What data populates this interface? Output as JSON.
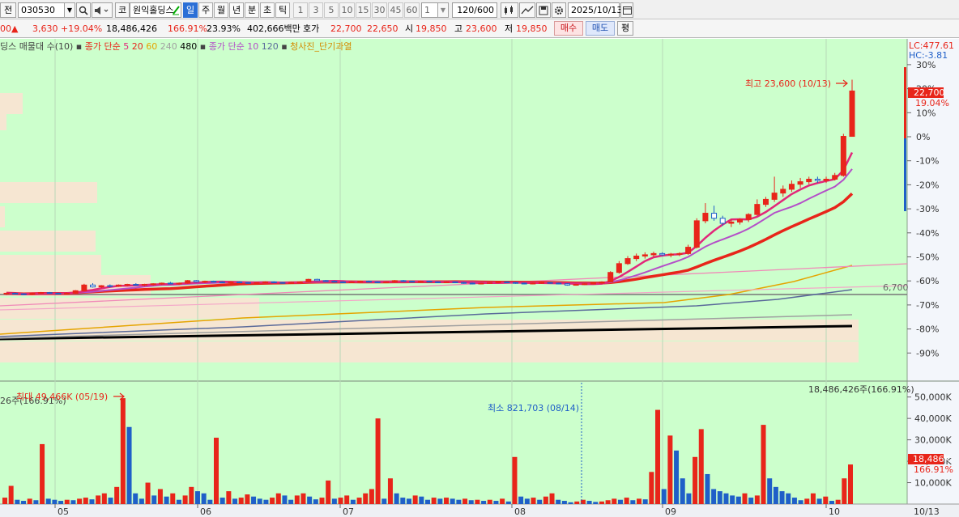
{
  "toolbar": {
    "mode_label": "전",
    "stock_code": "030530",
    "market_label": "코",
    "stock_name": "원익홀딩스",
    "timeframes": [
      "일",
      "주",
      "월",
      "년",
      "분",
      "초",
      "틱"
    ],
    "active_timeframe": "일",
    "intervals": [
      "1",
      "3",
      "5",
      "10",
      "15",
      "30",
      "45",
      "60"
    ],
    "interval_value": "1",
    "count_value": "120",
    "count_total": "/600",
    "date_value": "2025/10/13"
  },
  "quote": {
    "prev_price_fragment": "00",
    "change_arrow": "▲",
    "change": "3,630",
    "change_pct": "+19.04%",
    "volume": "18,486,426",
    "volume_ratio": "166.91%",
    "turnover": "23.93%",
    "amount": "402,666백만",
    "ask_label": "호가",
    "ask": "22,700",
    "bid": "22,650",
    "open_label": "시",
    "open": "19,850",
    "high_label": "고",
    "high": "23,600",
    "low_label": "저",
    "low": "19,850",
    "buy_label": "매수",
    "sell_label": "매도",
    "flat_label": "평"
  },
  "legend": {
    "item1": "딩스 매물대 수(10)",
    "item2_prefix": "종가 단순",
    "ma_a": [
      "5",
      "20",
      "60",
      "240",
      "480"
    ],
    "item3_prefix": "종가 단순",
    "ma_b": [
      "10",
      "120"
    ],
    "item4": "청사진_단기과열"
  },
  "colors": {
    "background": "#ccffcc",
    "up": "#e8251a",
    "down": "#1f5fc8",
    "ma5": "#e2277a",
    "ma10": "#b44fc8",
    "ma20": "#e8251a",
    "ma60": "#e5a400",
    "ma120": "#5a6a9a",
    "ma240": "#a0a0a0",
    "ma480": "#000000"
  },
  "price_panel": {
    "lc_label": "LC:477.61",
    "hc_label": "HC:-3.81",
    "y_ticks": [
      "30%",
      "20%",
      "10%",
      "0%",
      "-10%",
      "-20%",
      "-30%",
      "-40%",
      "-50%",
      "-60%",
      "-70%",
      "-80%",
      "-90%"
    ],
    "current_price": "22,700",
    "current_pct": "19.04%",
    "max_label": "최고 23,600 (10/13)",
    "line_label": "6,700"
  },
  "volume_panel": {
    "top_right_label": "18,486,426주(166.91%)",
    "top_left_label": "26주(166.91%)",
    "max_label": "최대 49,466K (05/19)",
    "min_label": "최소 821,703 (08/14)",
    "y_ticks": [
      "50,000K",
      "40,000K",
      "30,000K",
      "20,000K",
      "10,000K"
    ],
    "current_volume": "18,486K",
    "current_pct": "166.91%"
  },
  "x_axis": {
    "months": [
      "05",
      "06",
      "07",
      "08",
      "09",
      "10"
    ],
    "cursor_date": "10/13"
  },
  "chart_data": {
    "type": "candlestick",
    "x_months": [
      "05",
      "06",
      "07",
      "08",
      "09",
      "10"
    ],
    "price_candles_ohlc": [
      [
        6600,
        6700,
        6500,
        6650
      ],
      [
        6650,
        6700,
        6550,
        6600
      ],
      [
        6600,
        6650,
        6500,
        6550
      ],
      [
        6550,
        6700,
        6500,
        6650
      ],
      [
        6650,
        6750,
        6600,
        6700
      ],
      [
        6700,
        6750,
        6600,
        6650
      ],
      [
        6650,
        6700,
        6550,
        6600
      ],
      [
        6600,
        6700,
        6550,
        6650
      ],
      [
        6650,
        6900,
        6600,
        6850
      ],
      [
        6850,
        7400,
        6800,
        7300
      ],
      [
        7300,
        7450,
        7100,
        7150
      ],
      [
        7150,
        7300,
        7050,
        7250
      ],
      [
        7250,
        7350,
        7100,
        7200
      ],
      [
        7200,
        7350,
        7150,
        7300
      ],
      [
        7300,
        7400,
        7200,
        7350
      ],
      [
        7350,
        7450,
        7250,
        7300
      ],
      [
        7300,
        7400,
        7200,
        7350
      ],
      [
        7350,
        7450,
        7250,
        7400
      ],
      [
        7400,
        7500,
        7300,
        7450
      ],
      [
        7450,
        7550,
        7350,
        7400
      ],
      [
        7400,
        7500,
        7300,
        7450
      ],
      [
        7450,
        7700,
        7400,
        7650
      ],
      [
        7650,
        7700,
        7500,
        7550
      ],
      [
        7550,
        7650,
        7450,
        7600
      ],
      [
        7600,
        7650,
        7500,
        7550
      ],
      [
        7550,
        7600,
        7450,
        7500
      ],
      [
        7500,
        7600,
        7450,
        7550
      ],
      [
        7550,
        7600,
        7450,
        7500
      ],
      [
        7500,
        7550,
        7400,
        7450
      ],
      [
        7450,
        7550,
        7400,
        7500
      ],
      [
        7500,
        7600,
        7450,
        7550
      ],
      [
        7550,
        7600,
        7450,
        7500
      ],
      [
        7500,
        7550,
        7400,
        7450
      ],
      [
        7450,
        7550,
        7400,
        7500
      ],
      [
        7500,
        7600,
        7450,
        7550
      ],
      [
        7550,
        7800,
        7500,
        7750
      ],
      [
        7750,
        7800,
        7600,
        7650
      ],
      [
        7650,
        7700,
        7550,
        7600
      ],
      [
        7600,
        7650,
        7500,
        7550
      ],
      [
        7550,
        7600,
        7450,
        7500
      ],
      [
        7500,
        7600,
        7450,
        7550
      ],
      [
        7550,
        7650,
        7500,
        7600
      ],
      [
        7600,
        7650,
        7500,
        7550
      ],
      [
        7550,
        7600,
        7450,
        7500
      ],
      [
        7500,
        7600,
        7450,
        7550
      ],
      [
        7550,
        7700,
        7500,
        7650
      ],
      [
        7650,
        7700,
        7550,
        7600
      ],
      [
        7600,
        7650,
        7500,
        7550
      ],
      [
        7550,
        7650,
        7500,
        7600
      ],
      [
        7600,
        7650,
        7500,
        7550
      ],
      [
        7550,
        7600,
        7450,
        7500
      ],
      [
        7500,
        7600,
        7450,
        7550
      ],
      [
        7550,
        7600,
        7450,
        7500
      ],
      [
        7500,
        7550,
        7400,
        7450
      ],
      [
        7450,
        7500,
        7350,
        7400
      ],
      [
        7400,
        7500,
        7350,
        7450
      ],
      [
        7450,
        7550,
        7400,
        7500
      ],
      [
        7500,
        7600,
        7450,
        7550
      ],
      [
        7550,
        7600,
        7450,
        7500
      ],
      [
        7500,
        7550,
        7400,
        7450
      ],
      [
        7450,
        7500,
        7350,
        7400
      ],
      [
        7400,
        7500,
        7350,
        7450
      ],
      [
        7450,
        7550,
        7400,
        7500
      ],
      [
        7500,
        7550,
        7400,
        7450
      ],
      [
        7450,
        7500,
        7350,
        7400
      ],
      [
        7400,
        7450,
        7250,
        7300
      ],
      [
        7300,
        7400,
        7250,
        7350
      ],
      [
        7350,
        7450,
        7300,
        7400
      ],
      [
        7400,
        7500,
        7350,
        7450
      ],
      [
        7450,
        7600,
        7400,
        7550
      ],
      [
        7550,
        8400,
        7500,
        8300
      ],
      [
        8300,
        9200,
        8200,
        9000
      ],
      [
        9000,
        9600,
        8900,
        9400
      ],
      [
        9400,
        9800,
        9200,
        9600
      ],
      [
        9600,
        9900,
        9400,
        9700
      ],
      [
        9700,
        9950,
        9500,
        9800
      ],
      [
        9800,
        9900,
        9600,
        9700
      ],
      [
        9700,
        9850,
        9500,
        9750
      ],
      [
        9750,
        9900,
        9600,
        9800
      ],
      [
        9800,
        10500,
        9700,
        10300
      ],
      [
        10300,
        12600,
        10200,
        12400
      ],
      [
        12400,
        13800,
        12200,
        13000
      ],
      [
        13000,
        13600,
        12400,
        12600
      ],
      [
        12600,
        12800,
        12000,
        12200
      ],
      [
        12200,
        12500,
        11900,
        12300
      ],
      [
        12300,
        12600,
        12100,
        12500
      ],
      [
        12500,
        13000,
        12300,
        12900
      ],
      [
        12900,
        14100,
        12800,
        13700
      ],
      [
        13700,
        14300,
        13500,
        14100
      ],
      [
        14100,
        15900,
        13900,
        14600
      ],
      [
        14600,
        15200,
        14300,
        14900
      ],
      [
        14900,
        15600,
        14700,
        15300
      ],
      [
        15300,
        15800,
        15000,
        15500
      ],
      [
        15500,
        15900,
        15300,
        15700
      ],
      [
        15700,
        15900,
        15400,
        15600
      ],
      [
        15600,
        15900,
        15400,
        15700
      ],
      [
        15700,
        16200,
        15600,
        16000
      ],
      [
        16000,
        19300,
        15900,
        19100
      ],
      [
        19100,
        23600,
        19850,
        22700
      ]
    ],
    "series": [
      {
        "name": "5",
        "color": "#e2277a"
      },
      {
        "name": "20",
        "color": "#e8251a"
      },
      {
        "name": "60",
        "color": "#e5a400"
      },
      {
        "name": "240",
        "color": "#a0a0a0"
      },
      {
        "name": "480",
        "color": "#000000"
      },
      {
        "name": "10",
        "color": "#b44fc8"
      },
      {
        "name": "120",
        "color": "#5a6a9a"
      }
    ],
    "volume_values_k": [
      3000,
      8500,
      2000,
      1500,
      2500,
      1800,
      28000,
      2500,
      2000,
      1500,
      2000,
      1800,
      2500,
      3000,
      2200,
      4000,
      5000,
      3000,
      8000,
      49466,
      36000,
      5000,
      2500,
      10000,
      4000,
      7000,
      3500,
      5000,
      2000,
      4000,
      8000,
      6000,
      5000,
      2000,
      31000,
      3000,
      6000,
      2500,
      3000,
      4500,
      3500,
      2500,
      2000,
      3000,
      5000,
      4000,
      2000,
      4000,
      5000,
      3500,
      2200,
      3000,
      11000,
      2500,
      3000,
      4000,
      2000,
      3000,
      5000,
      7000,
      40000,
      2500,
      12000,
      5000,
      3000,
      2500,
      4000,
      3500,
      2000,
      3000,
      2500,
      3000,
      2500,
      2000,
      2500,
      1800,
      2000,
      1500,
      2000,
      1500,
      2500,
      1200,
      22000,
      3500,
      2500,
      3000,
      2000,
      3500,
      5000,
      2000,
      1500,
      821,
      1200,
      2000,
      1500,
      1000,
      1200,
      1800,
      2500,
      2000,
      3000,
      1800,
      2500,
      2200,
      15000,
      44000,
      7000,
      32000,
      25000,
      12000,
      5000,
      22000,
      35000,
      14000,
      7000,
      6000,
      5000,
      4000,
      3500,
      5000,
      3000,
      4000,
      37000,
      12000,
      8000,
      6000,
      5000,
      3000,
      1800,
      2500,
      5000,
      2500,
      3500,
      1500,
      2000,
      12000,
      18486
    ]
  }
}
